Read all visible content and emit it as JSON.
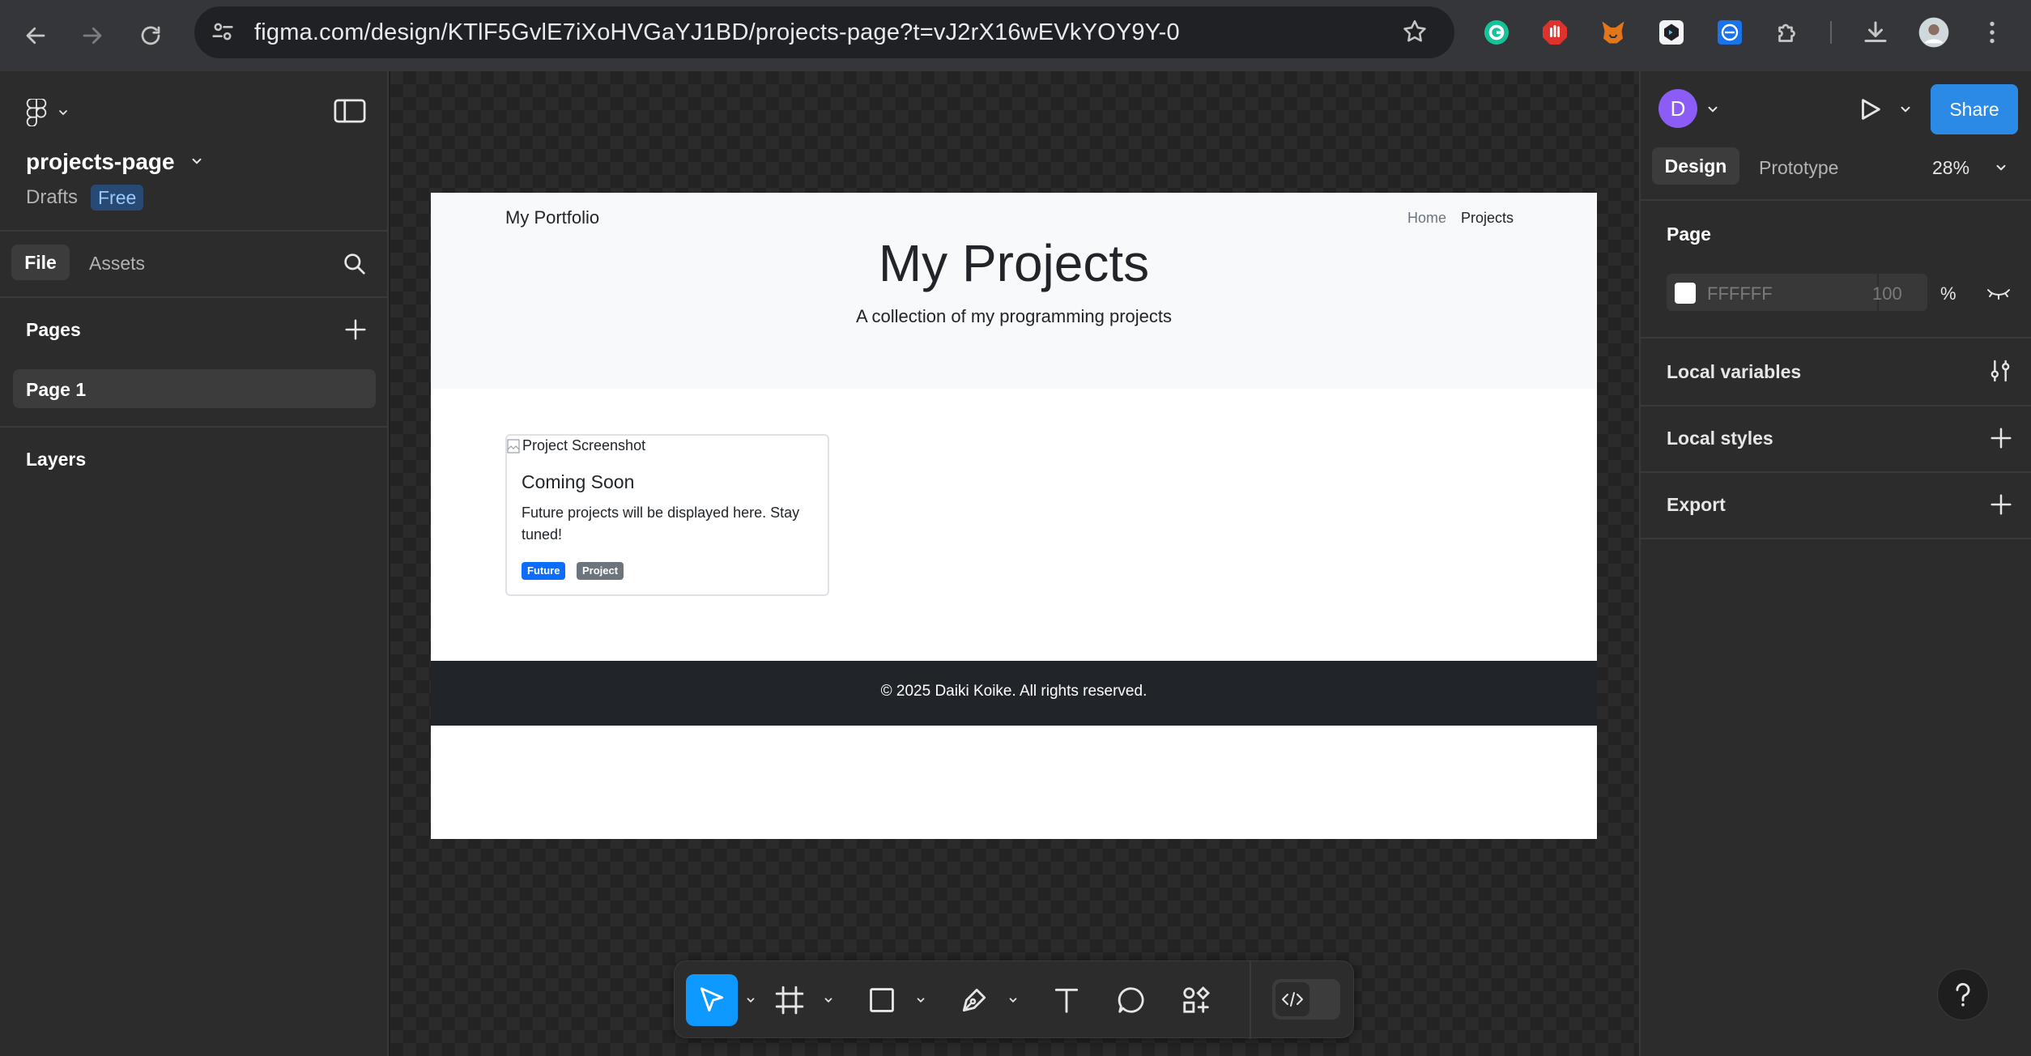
{
  "browser": {
    "url": "figma.com/design/KTlF5GvlE7iXoHVGaYJ1BD/projects-page?t=vJ2rX16wEVkYOY9Y-0",
    "extensions": [
      "grammarly-icon",
      "adblock-icon",
      "metamask-icon",
      "extension-icon",
      "extension-icon",
      "extensions-puzzle-icon"
    ]
  },
  "left_panel": {
    "file_name": "projects-page",
    "location": "Drafts",
    "plan_badge": "Free",
    "tabs": {
      "file": "File",
      "assets": "Assets"
    },
    "pages_heading": "Pages",
    "pages": [
      "Page 1"
    ],
    "layers_heading": "Layers"
  },
  "frame": {
    "nav_brand": "My Portfolio",
    "nav_links": [
      "Home",
      "Projects"
    ],
    "hero_title": "My Projects",
    "hero_subtitle": "A collection of my programming projects",
    "card": {
      "image_alt": "Project Screenshot",
      "title": "Coming Soon",
      "text": "Future projects will be displayed here. Stay tuned!",
      "tags": [
        "Future",
        "Project"
      ]
    },
    "footer": "© 2025 Daiki Koike. All rights reserved."
  },
  "right_panel": {
    "avatar_letter": "D",
    "share_label": "Share",
    "tabs": {
      "design": "Design",
      "prototype": "Prototype"
    },
    "zoom": "28%",
    "page_heading": "Page",
    "page_color": "FFFFFF",
    "page_opacity": "100",
    "percent_sign": "%",
    "sections": [
      "Local variables",
      "Local styles",
      "Export"
    ]
  },
  "colors": {
    "accent": "#0d99ff",
    "share": "#2b8ae6",
    "avatar": "#8b5cf6",
    "tag_future": "#0d6efd",
    "tag_project": "#6c757d"
  }
}
